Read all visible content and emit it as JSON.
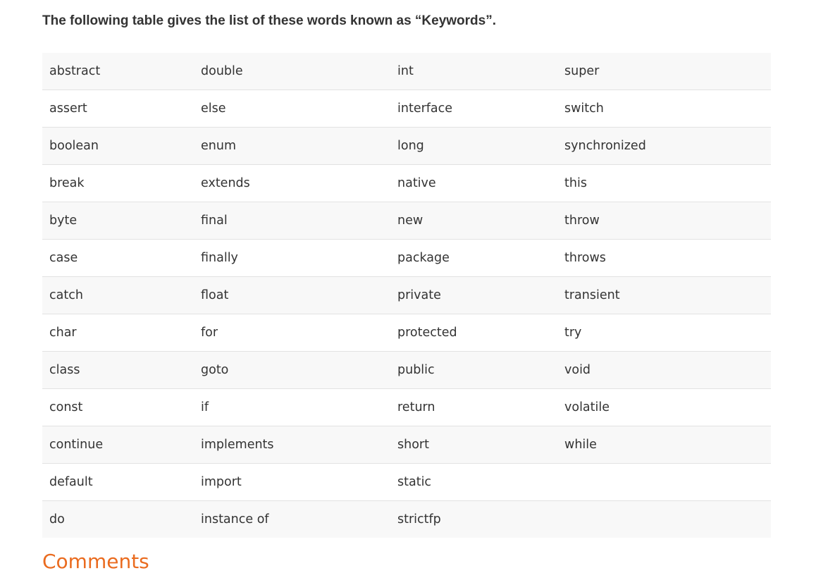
{
  "intro_text": "The following table gives the list of these words known as “Keywords”.",
  "keywords_table": {
    "rows": [
      [
        "abstract",
        "double",
        "int",
        "super"
      ],
      [
        "assert",
        "else",
        "interface",
        "switch"
      ],
      [
        "boolean",
        "enum",
        "long",
        "synchronized"
      ],
      [
        "break",
        "extends",
        "native",
        "this"
      ],
      [
        "byte",
        "final",
        "new",
        "throw"
      ],
      [
        "case",
        "finally",
        "package",
        "throws"
      ],
      [
        "catch",
        "float",
        "private",
        "transient"
      ],
      [
        "char",
        "for",
        "protected",
        "try"
      ],
      [
        "class",
        "goto",
        "public",
        "void"
      ],
      [
        "const",
        "if",
        "return",
        "volatile"
      ],
      [
        "continue",
        "implements",
        "short",
        "while"
      ],
      [
        "default",
        "import",
        "static",
        ""
      ],
      [
        "do",
        "instance of",
        "strictfp",
        ""
      ]
    ]
  },
  "next_heading": "Comments",
  "colors": {
    "heading_accent": "#ea6b1f",
    "row_alt": "#f8f8f8"
  }
}
